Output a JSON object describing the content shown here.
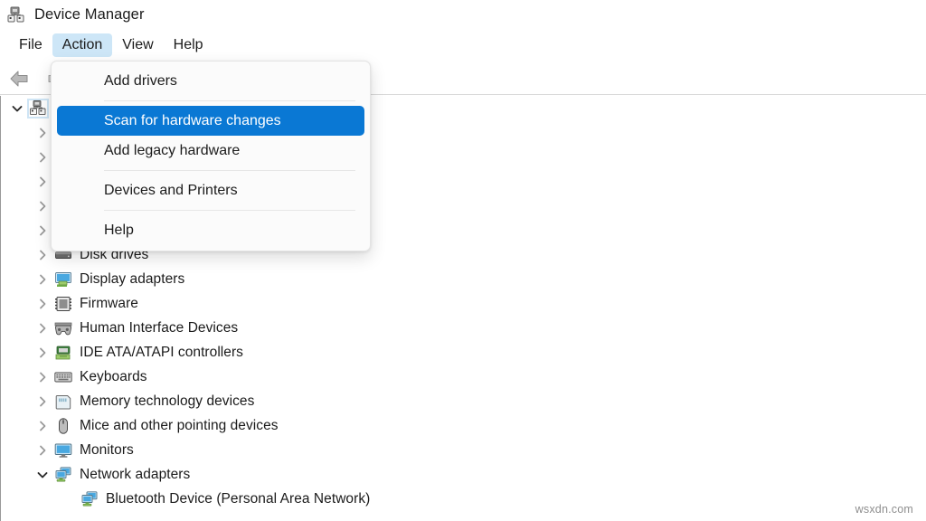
{
  "window": {
    "title": "Device Manager",
    "title_icon": "device-manager-icon"
  },
  "menubar": {
    "items": [
      {
        "label": "File",
        "active": false
      },
      {
        "label": "Action",
        "active": true
      },
      {
        "label": "View",
        "active": false
      },
      {
        "label": "Help",
        "active": false
      }
    ]
  },
  "toolbar": {
    "buttons": [
      {
        "icon": "back-arrow-icon"
      },
      {
        "icon": "forward-arrow-icon"
      }
    ]
  },
  "action_menu": {
    "items": [
      {
        "label": "Add drivers",
        "highlighted": false,
        "separator_after": true
      },
      {
        "label": "Scan for hardware changes",
        "highlighted": true,
        "separator_after": false
      },
      {
        "label": "Add legacy hardware",
        "highlighted": false,
        "separator_after": true
      },
      {
        "label": "Devices and Printers",
        "highlighted": false,
        "separator_after": true
      },
      {
        "label": "Help",
        "highlighted": false,
        "separator_after": false
      }
    ]
  },
  "device_tree": {
    "nodes": [
      {
        "label": "",
        "icon": "computer-icon",
        "expander": "expanded",
        "indent": 0,
        "selected": true
      },
      {
        "label": "",
        "icon": "",
        "expander": "collapsed",
        "indent": 1,
        "selected": false
      },
      {
        "label": "",
        "icon": "",
        "expander": "collapsed",
        "indent": 1,
        "selected": false
      },
      {
        "label": "",
        "icon": "",
        "expander": "collapsed",
        "indent": 1,
        "selected": false
      },
      {
        "label": "",
        "icon": "",
        "expander": "collapsed",
        "indent": 1,
        "selected": false
      },
      {
        "label": "",
        "icon": "",
        "expander": "collapsed",
        "indent": 1,
        "selected": false
      },
      {
        "label": "Disk drives",
        "icon": "disk-drive-icon",
        "expander": "collapsed",
        "indent": 1,
        "selected": false
      },
      {
        "label": "Display adapters",
        "icon": "display-adapter-icon",
        "expander": "collapsed",
        "indent": 1,
        "selected": false
      },
      {
        "label": "Firmware",
        "icon": "firmware-chip-icon",
        "expander": "collapsed",
        "indent": 1,
        "selected": false
      },
      {
        "label": "Human Interface Devices",
        "icon": "gamepad-icon",
        "expander": "collapsed",
        "indent": 1,
        "selected": false
      },
      {
        "label": "IDE ATA/ATAPI controllers",
        "icon": "ide-controller-icon",
        "expander": "collapsed",
        "indent": 1,
        "selected": false
      },
      {
        "label": "Keyboards",
        "icon": "keyboard-icon",
        "expander": "collapsed",
        "indent": 1,
        "selected": false
      },
      {
        "label": "Memory technology devices",
        "icon": "memory-card-icon",
        "expander": "collapsed",
        "indent": 1,
        "selected": false
      },
      {
        "label": "Mice and other pointing devices",
        "icon": "mouse-icon",
        "expander": "collapsed",
        "indent": 1,
        "selected": false
      },
      {
        "label": "Monitors",
        "icon": "monitor-icon",
        "expander": "collapsed",
        "indent": 1,
        "selected": false
      },
      {
        "label": "Network adapters",
        "icon": "network-adapter-icon",
        "expander": "expanded",
        "indent": 1,
        "selected": false
      },
      {
        "label": "Bluetooth Device (Personal Area Network)",
        "icon": "network-adapter-icon",
        "expander": "none",
        "indent": 2,
        "selected": false
      }
    ]
  },
  "watermark": {
    "text": "wsxdn.com"
  },
  "colors": {
    "menu_highlight": "#0a78d4",
    "menubar_active": "#cde6f7",
    "text": "#1b1b1b",
    "menu_bg": "#fbfbfb",
    "separator": "#e6e6e6",
    "chevron": "#6b6b6b"
  }
}
